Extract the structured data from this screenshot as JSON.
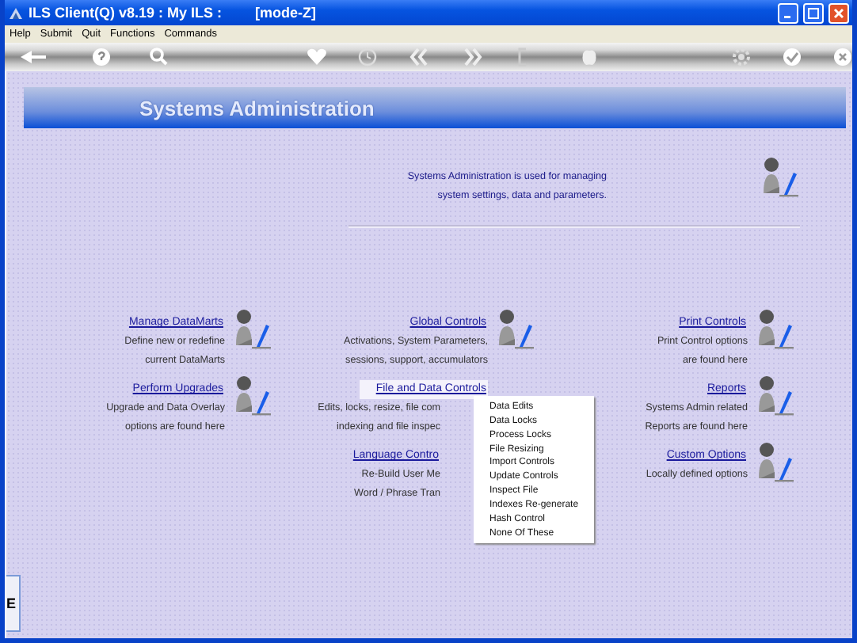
{
  "window": {
    "title": "ILS Client(Q) v8.19 : My ILS :",
    "mode": "[mode-Z]"
  },
  "menu_bar": [
    "Help",
    "Submit",
    "Quit",
    "Functions",
    "Commands"
  ],
  "page": {
    "title": "Systems Administration",
    "intro": [
      "Systems Administration is used for managing",
      "system settings, data and parameters."
    ]
  },
  "columns": [
    [
      {
        "link": "Manage DataMarts",
        "description": [
          "Define new or redefine",
          "current DataMarts"
        ],
        "menu_open": false
      },
      {
        "link": "Perform Upgrades",
        "description": [
          "Upgrade and Data Overlay",
          "options are found here"
        ],
        "menu_open": false
      }
    ],
    [
      {
        "link": "Global Controls",
        "description": [
          "Activations, System Parameters,",
          "sessions, support, accumulators"
        ],
        "menu_open": false
      },
      {
        "link": "File and Data Controls",
        "description": [
          "Edits, locks, resize, file com",
          "indexing and file inspec"
        ],
        "menu_open": true,
        "menu_items": [
          "Data Edits",
          "Data Locks",
          "Process Locks",
          "File Resizing",
          "Import Controls",
          "Update Controls",
          "Inspect File",
          "Indexes Re-generate",
          "Hash Control",
          "None Of These"
        ]
      },
      {
        "link": "Language Contro",
        "description": [
          "Re-Build User Me",
          "Word / Phrase Tran"
        ],
        "menu_open": false
      }
    ],
    [
      {
        "link": "Print Controls",
        "description": [
          "Print Control options",
          "are found here"
        ],
        "menu_open": false
      },
      {
        "link": "Reports",
        "description": [
          "Systems Admin related",
          "Reports are found here"
        ],
        "menu_open": false
      },
      {
        "link": "Custom Options",
        "description": [
          "Locally defined options"
        ],
        "menu_open": false
      }
    ]
  ],
  "side_tab": "E"
}
